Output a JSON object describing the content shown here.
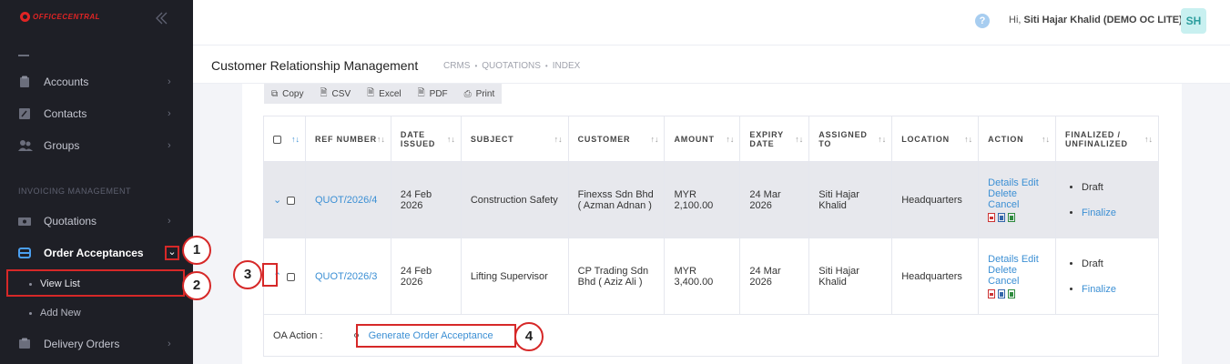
{
  "brand": {
    "logo_text": "OFFICECENTRAL"
  },
  "sidebar": {
    "items": [
      {
        "label": "Accounts"
      },
      {
        "label": "Contacts"
      },
      {
        "label": "Groups"
      }
    ],
    "section_title": "INVOICING MANAGEMENT",
    "invoicing_items": [
      {
        "label": "Quotations"
      },
      {
        "label": "Order Acceptances"
      },
      {
        "label": "Delivery Orders"
      }
    ],
    "sub_items": [
      {
        "label": "View List"
      },
      {
        "label": "Add New"
      }
    ]
  },
  "header": {
    "help": "?",
    "greeting_prefix": "Hi,",
    "user_name": "Siti Hajar Khalid (DEMO OC LITE)",
    "avatar_initials": "SH"
  },
  "page": {
    "title": "Customer Relationship Management",
    "breadcrumb": [
      "CRMS",
      "QUOTATIONS",
      "INDEX"
    ]
  },
  "toolbar": {
    "copy": "Copy",
    "csv": "CSV",
    "excel": "Excel",
    "pdf": "PDF",
    "print": "Print"
  },
  "table": {
    "headers": {
      "ref": "REF NUMBER",
      "date": "DATE ISSUED",
      "subject": "SUBJECT",
      "customer": "CUSTOMER",
      "amount": "AMOUNT",
      "expiry": "EXPIRY DATE",
      "assigned": "ASSIGNED TO",
      "location": "LOCATION",
      "action": "ACTION",
      "finalized": "FINALIZED / UNFINALIZED"
    },
    "sort_glyph": "↑↓",
    "rows": [
      {
        "ref": "QUOT/2026/4",
        "date": "24 Feb 2026",
        "subject": "Construction Safety",
        "customer": "Finexss Sdn Bhd ( Azman Adnan )",
        "amount": "MYR 2,100.00",
        "expiry": "24 Mar 2026",
        "assigned": "Siti Hajar Khalid",
        "location": "Headquarters",
        "actions": {
          "details": "Details",
          "edit": "Edit",
          "delete": "Delete",
          "cancel": "Cancel"
        },
        "status": "Draft",
        "finalize": "Finalize"
      },
      {
        "ref": "QUOT/2026/3",
        "date": "24 Feb 2026",
        "subject": "Lifting Supervisor",
        "customer": "CP Trading Sdn Bhd ( Aziz Ali )",
        "amount": "MYR 3,400.00",
        "expiry": "24 Mar 2026",
        "assigned": "Siti Hajar Khalid",
        "location": "Headquarters",
        "actions": {
          "details": "Details",
          "edit": "Edit",
          "delete": "Delete",
          "cancel": "Cancel"
        },
        "status": "Draft",
        "finalize": "Finalize"
      }
    ],
    "oa_action_label": "OA Action :",
    "oa_action_link": "Generate Order Acceptance"
  },
  "annotations": [
    "1",
    "2",
    "3",
    "4"
  ],
  "colors": {
    "accent": "#3b8fd4",
    "sidebar_bg": "#1e1f26",
    "callout": "#d62828"
  }
}
